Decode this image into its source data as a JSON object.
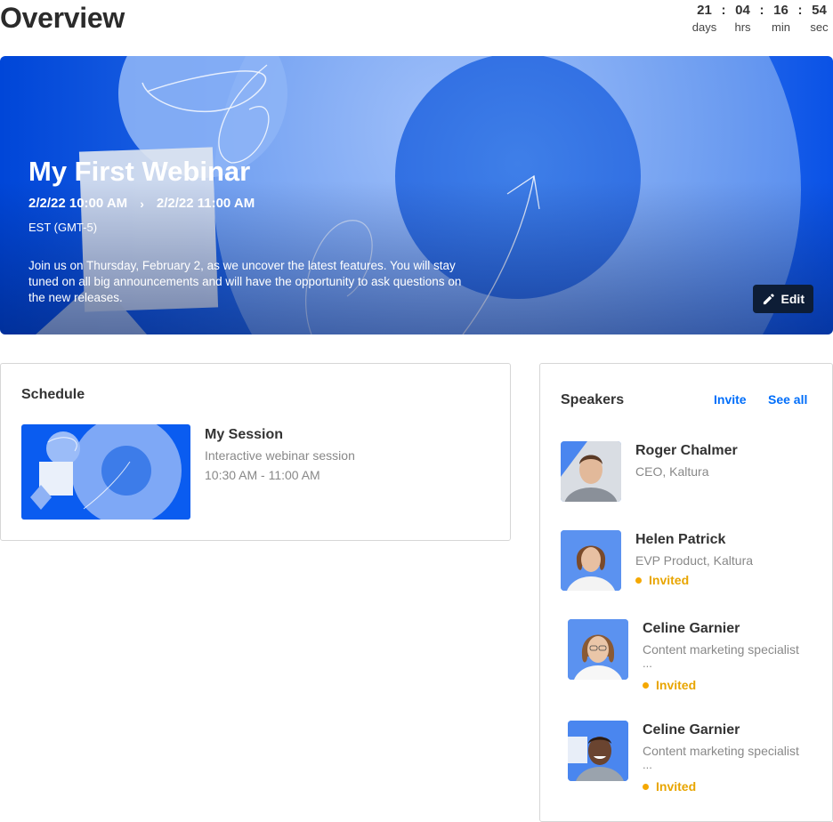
{
  "page": {
    "title": "Overview"
  },
  "countdown": {
    "days": "21",
    "days_label": "days",
    "hours": "04",
    "hours_label": "hrs",
    "minutes": "16",
    "minutes_label": "min",
    "seconds": "54",
    "seconds_label": "sec",
    "separator": ":"
  },
  "hero": {
    "title": "My First Webinar",
    "start": "2/2/22 10:00 AM",
    "end": "2/2/22 11:00 AM",
    "timezone": "EST (GMT-5)",
    "description": "Join us on Thursday, February 2, as we uncover the latest features. You will stay tuned on all big announcements and will have the opportunity to ask questions on the new releases.",
    "edit_label": "Edit",
    "colors": {
      "primary": "#0046d8",
      "edit_bg": "#0d1d36"
    }
  },
  "schedule": {
    "title": "Schedule",
    "sessions": [
      {
        "name": "My Session",
        "description": "Interactive webinar session",
        "time": "10:30 AM - 11:00 AM"
      }
    ]
  },
  "speakers": {
    "title": "Speakers",
    "invite_label": "Invite",
    "see_all_label": "See all",
    "link_color": "#006efa",
    "status_color": "#f5a800",
    "items": [
      {
        "name": "Roger Chalmer",
        "role": "CEO, Kaltura",
        "status": ""
      },
      {
        "name": "Helen Patrick",
        "role": "EVP Product, Kaltura",
        "status": "Invited"
      },
      {
        "name": "Celine Garnier",
        "role": "Content marketing specialist",
        "ellipsis": "...",
        "status": "Invited"
      },
      {
        "name": "Celine Garnier",
        "role": "Content marketing specialist",
        "ellipsis": "...",
        "status": "Invited"
      }
    ]
  }
}
